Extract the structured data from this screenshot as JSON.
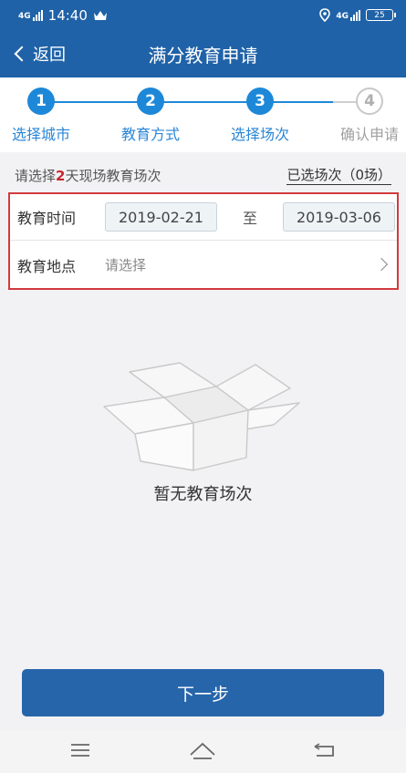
{
  "status_bar": {
    "network": "4G",
    "time": "14:40",
    "net_right": "4G",
    "battery": "25"
  },
  "nav": {
    "back_label": "返回",
    "title": "满分教育申请"
  },
  "steps": [
    {
      "num": "1",
      "label": "选择城市",
      "active": true
    },
    {
      "num": "2",
      "label": "教育方式",
      "active": true
    },
    {
      "num": "3",
      "label": "选择场次",
      "active": true
    },
    {
      "num": "4",
      "label": "确认申请",
      "active": false
    }
  ],
  "info": {
    "prefix": "请选择",
    "count": "2",
    "suffix": "天现场教育场次",
    "selected_link": "已选场次（0场）"
  },
  "form": {
    "time_label": "教育时间",
    "start_date": "2019-02-21",
    "to_label": "至",
    "end_date": "2019-03-06",
    "place_label": "教育地点",
    "place_value": "请选择"
  },
  "empty": {
    "text": "暂无教育场次"
  },
  "next_button": "下一步",
  "colors": {
    "primary": "#1f62a8",
    "step_active": "#1e88d8",
    "highlight_red": "#c6262e",
    "box_border": "#d23a3e"
  }
}
